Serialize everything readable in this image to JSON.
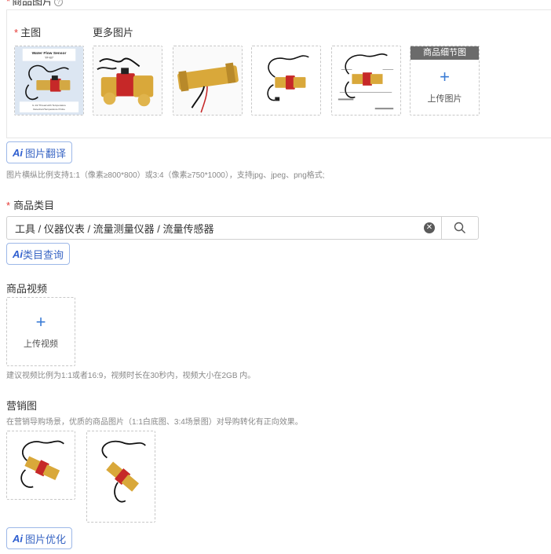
{
  "product_images": {
    "label": "商品图片",
    "main_label": "主图",
    "more_label": "更多图片",
    "main_image_title": "Water Flow Sensor",
    "main_image_model": "YF-B7",
    "main_image_caption_1": "G 1/2 Thread with Temperature",
    "main_image_caption_2": "Detection/Temperature Probe",
    "detail_header": "商品细节图",
    "upload_image": "上传图片",
    "translate_btn": "图片翻译",
    "hint": "图片横纵比例支持1:1（像素≥800*800）或3:4（像素≥750*1000），支持jpg、jpeg、png格式;"
  },
  "category": {
    "label": "商品类目",
    "value": "工具 / 仪器仪表 / 流量测量仪器 / 流量传感器",
    "query_btn": "类目查询"
  },
  "video": {
    "label": "商品视频",
    "upload": "上传视频",
    "hint": "建议视频比例为1:1或者16:9，视频时长在30秒内，视频大小在2GB 内。"
  },
  "marketing": {
    "label": "营销图",
    "hint": "在营销导购场景，优质的商品图片（1:1白底图、3:4场景图）对导购转化有正向效果。",
    "optimize_btn": "图片优化"
  },
  "ai_mark": "Ai",
  "colors": {
    "accent": "#3a66c4",
    "required": "#e53935",
    "brass": "#c9a24a",
    "red_body": "#c62828"
  }
}
